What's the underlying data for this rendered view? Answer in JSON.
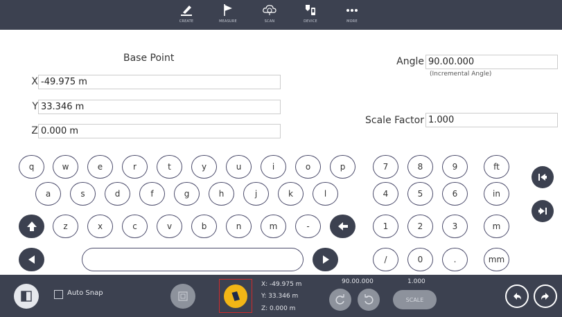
{
  "toolbar": {
    "items": [
      {
        "label": "CREATE",
        "icon": "pencil-icon"
      },
      {
        "label": "MEASURE",
        "icon": "flag-icon"
      },
      {
        "label": "SCAN",
        "icon": "cloud-scan-icon"
      },
      {
        "label": "DEVICE",
        "icon": "device-icon"
      },
      {
        "label": "MORE",
        "icon": "more-dots-icon"
      }
    ]
  },
  "form": {
    "base_point_title": "Base Point",
    "x_label": "X",
    "x_value": "-49.975 m",
    "y_label": "Y",
    "y_value": "33.346 m",
    "z_label": "Z",
    "z_value": "0.000 m",
    "angle_label": "Angle",
    "angle_value": "90.00.000",
    "angle_note": "(Incremental Angle)",
    "scale_label": "Scale Factor",
    "scale_value": "1.000"
  },
  "keyboard": {
    "row1": [
      "q",
      "w",
      "e",
      "r",
      "t",
      "y",
      "u",
      "i",
      "o",
      "p"
    ],
    "row2": [
      "a",
      "s",
      "d",
      "f",
      "g",
      "h",
      "j",
      "k",
      "l"
    ],
    "row3": [
      "z",
      "x",
      "c",
      "v",
      "b",
      "n",
      "m",
      "-"
    ],
    "num1": [
      "7",
      "8",
      "9",
      "ft"
    ],
    "num2": [
      "4",
      "5",
      "6",
      "in"
    ],
    "num3": [
      "1",
      "2",
      "3",
      "m"
    ],
    "num4": [
      "/",
      "0",
      ".",
      "mm"
    ]
  },
  "bottom": {
    "auto_snap_label": "Auto Snap",
    "coord_x": "X: -49.975 m",
    "coord_y": "Y: 33.346 m",
    "coord_z": "Z: 0.000 m",
    "angle_readout": "90.00.000",
    "scale_readout": "1.000",
    "scale_button": "SCALE"
  },
  "colors": {
    "bar_background": "#3c4150",
    "accent_yellow": "#f2b616",
    "highlight_red": "#d12b2b"
  }
}
